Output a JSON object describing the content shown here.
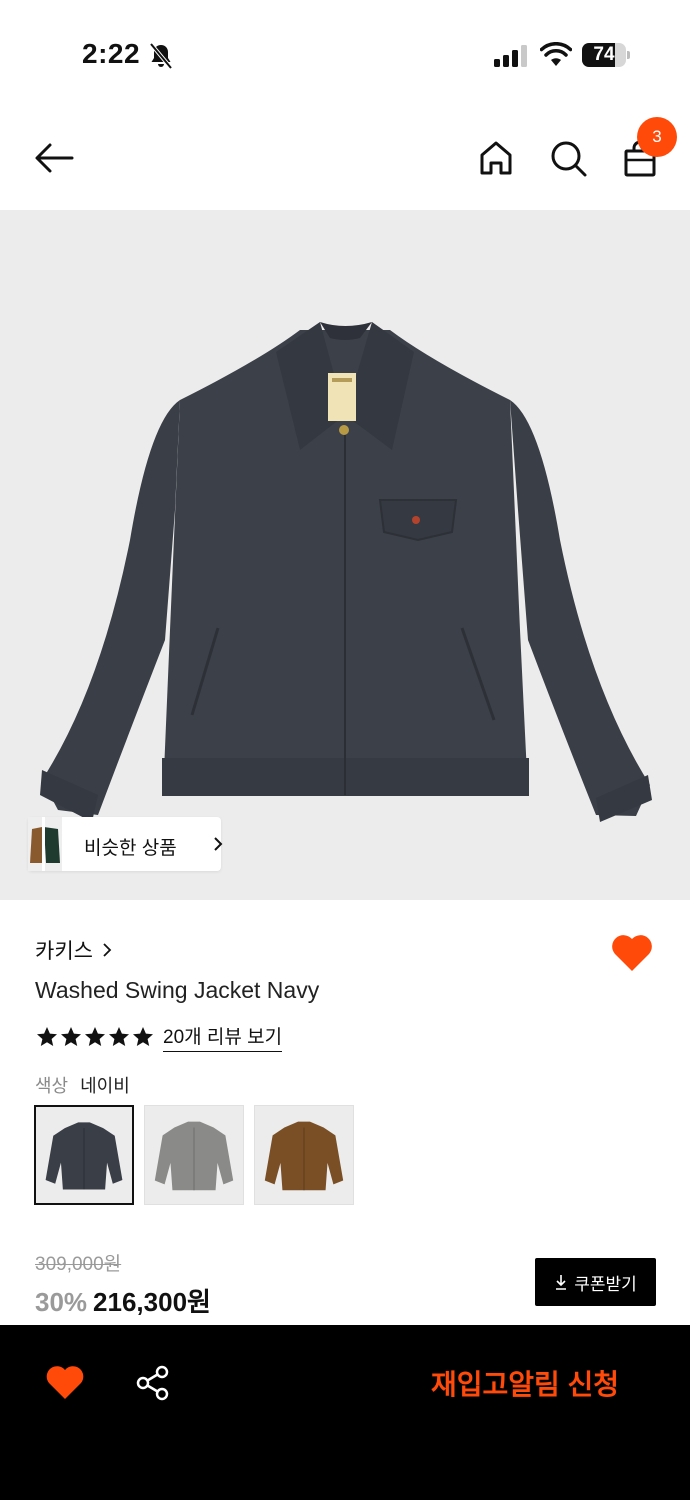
{
  "status_bar": {
    "time": "2:22",
    "battery_level": "74",
    "battery_fraction": 0.74,
    "icons": [
      "bell-slash-icon",
      "cellular-signal-icon",
      "wifi-icon",
      "battery-icon"
    ]
  },
  "header": {
    "icons": [
      "back-arrow-icon",
      "home-icon",
      "search-icon",
      "shopping-bag-icon"
    ],
    "cart_count": "3"
  },
  "hero": {
    "similar_products_label": "비슷한 상품"
  },
  "product": {
    "brand": "카키스",
    "name": "Washed Swing Jacket Navy",
    "rating_stars": 5,
    "review_link": "20개 리뷰 보기",
    "color_label": "색상",
    "color_value": "네이비",
    "swatches": [
      {
        "color": "#3a3e47",
        "selected": true
      },
      {
        "color": "#8a8a88",
        "selected": false
      },
      {
        "color": "#7a4f26",
        "selected": false
      }
    ],
    "original_price": "309,000원",
    "discount": "30%",
    "final_price": "216,300원",
    "coupon_label": "쿠폰받기"
  },
  "bottom_bar": {
    "restock_label": "재입고알림 신청"
  },
  "colors": {
    "accent": "#ff4a0a",
    "jacket_navy": "#3a3e47",
    "hero_bg": "#ececec"
  }
}
